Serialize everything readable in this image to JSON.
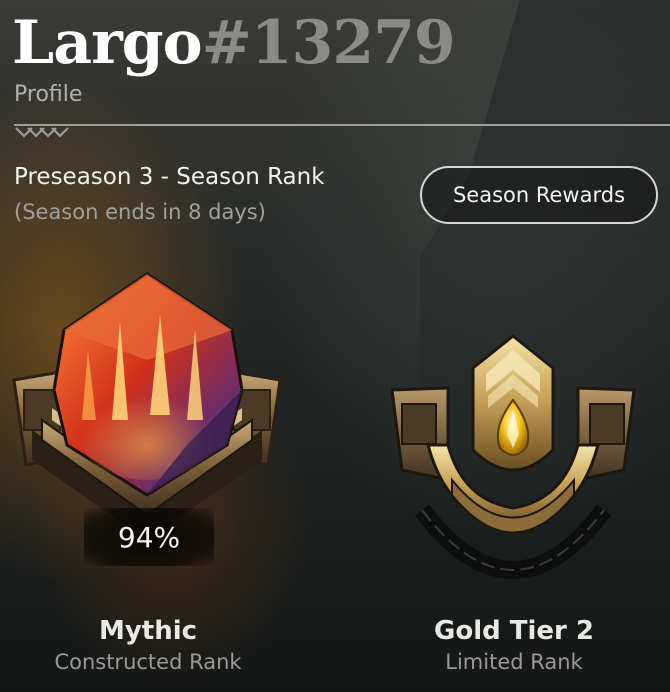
{
  "header": {
    "player_name": "Largo",
    "player_tag": "#13279",
    "subtitle": "Profile"
  },
  "season": {
    "title": "Preseason 3 - Season Rank",
    "ends_text": "(Season ends in 8 days)",
    "rewards_button_label": "Season Rewards"
  },
  "ranks": {
    "constructed": {
      "tier": "Mythic",
      "type": "Constructed Rank",
      "percent": "94%",
      "emblem_icon": "mythic-rank-emblem"
    },
    "limited": {
      "tier": "Gold Tier 2",
      "type": "Limited Rank",
      "emblem_icon": "gold-rank-emblem"
    }
  },
  "colors": {
    "mythic_gem": "#e0401a",
    "gold": "#c9a45a",
    "bronze_frame": "#8c7048"
  }
}
